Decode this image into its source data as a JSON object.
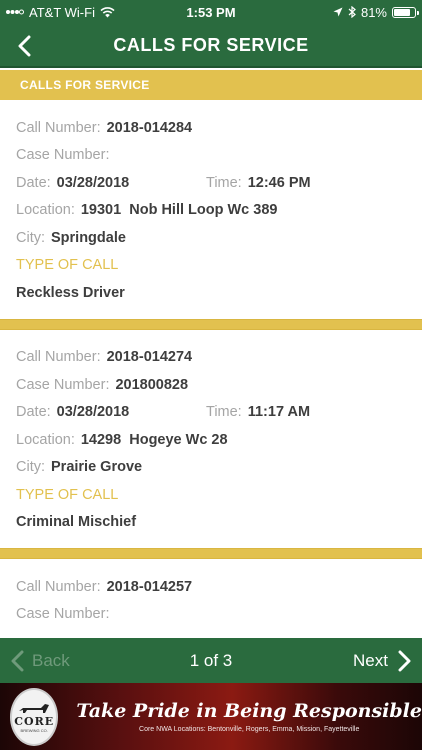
{
  "status_bar": {
    "carrier": "AT&T Wi-Fi",
    "time": "1:53 PM",
    "battery_percent": "81%",
    "battery_level": 0.81
  },
  "nav": {
    "title": "CALLS FOR SERVICE"
  },
  "section": {
    "header": "CALLS FOR SERVICE"
  },
  "labels": {
    "call_number": "Call Number:",
    "case_number": "Case Number:",
    "date": "Date:",
    "time": "Time:",
    "location": "Location:",
    "city": "City:",
    "type_of_call": "TYPE OF CALL"
  },
  "calls": [
    {
      "call_number": "2018-014284",
      "case_number": "",
      "date": "03/28/2018",
      "time": "12:46 PM",
      "location": "19301  Nob Hill Loop Wc 389",
      "city": "Springdale",
      "type": "Reckless Driver"
    },
    {
      "call_number": "2018-014274",
      "case_number": "201800828",
      "date": "03/28/2018",
      "time": "11:17 AM",
      "location": "14298  Hogeye Wc 28",
      "city": "Prairie Grove",
      "type": "Criminal Mischief"
    },
    {
      "call_number": "2018-014257",
      "case_number": "",
      "date": "",
      "time": "",
      "location": "",
      "city": "",
      "type": ""
    }
  ],
  "pagination": {
    "back_label": "Back",
    "page_indicator": "1 of 3",
    "next_label": "Next"
  },
  "banner": {
    "logo_text": "CORE",
    "logo_subtext": "BREWING CO.",
    "slogan": "Take Pride in Being Responsible",
    "locations": "Core NWA Locations: Bentonville, Rogers, Emma, Mission, Fayetteville"
  },
  "colors": {
    "primary_green": "#2a6b3e",
    "accent_gold": "#e2c14f"
  }
}
